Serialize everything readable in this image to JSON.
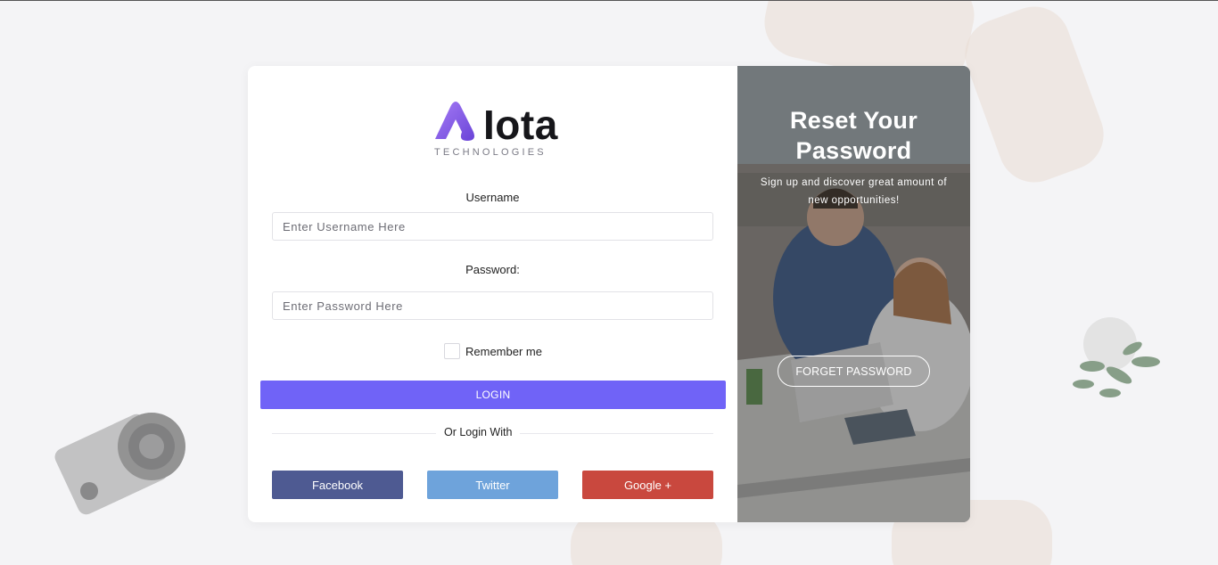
{
  "brand": {
    "name": "Iota",
    "tagline": "TECHNOLOGIES",
    "accent": "#7063f7"
  },
  "form": {
    "username_label": "Username",
    "username_placeholder": "Enter Username Here",
    "password_label": "Password:",
    "password_placeholder": "Enter Password Here",
    "remember_label": "Remember me",
    "login_label": "LOGIN",
    "divider_text": "Or Login With"
  },
  "social": {
    "facebook": {
      "label": "Facebook",
      "color": "#4e5a92"
    },
    "twitter": {
      "label": "Twitter",
      "color": "#6ea3db"
    },
    "google": {
      "label": "Google +",
      "color": "#c9483e"
    }
  },
  "panel": {
    "title": "Reset Your Password",
    "text": "Sign up and discover great amount of new opportunities!",
    "button_label": "FORGET PASSWORD"
  }
}
